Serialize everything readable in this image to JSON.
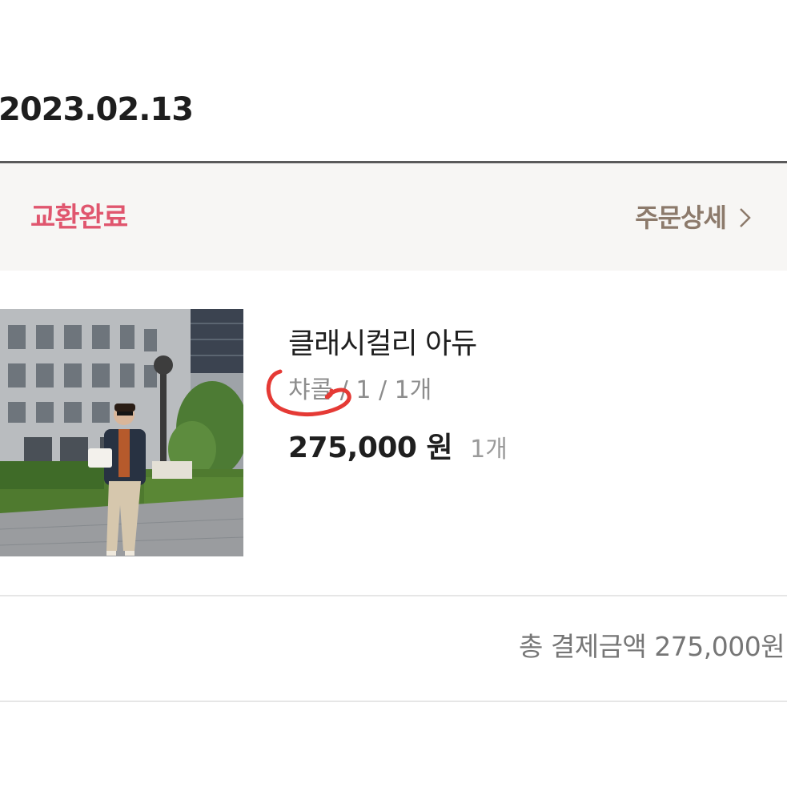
{
  "order": {
    "date": "2023.02.13",
    "status": "교환완료",
    "detail_link": "주문상세"
  },
  "item": {
    "name": "클래시컬리 아듀",
    "option": "챠콜 / 1 / 1개",
    "price": "275,000 원",
    "quantity": "1개",
    "thumbnail_alt": "woman in dark blazer holding white bag in front of stone building"
  },
  "summary": {
    "total": "총 결제금액 275,000원"
  },
  "colors": {
    "status": "#e0566e",
    "detail_link": "#8c7a6b",
    "annotation": "#e53a35"
  }
}
